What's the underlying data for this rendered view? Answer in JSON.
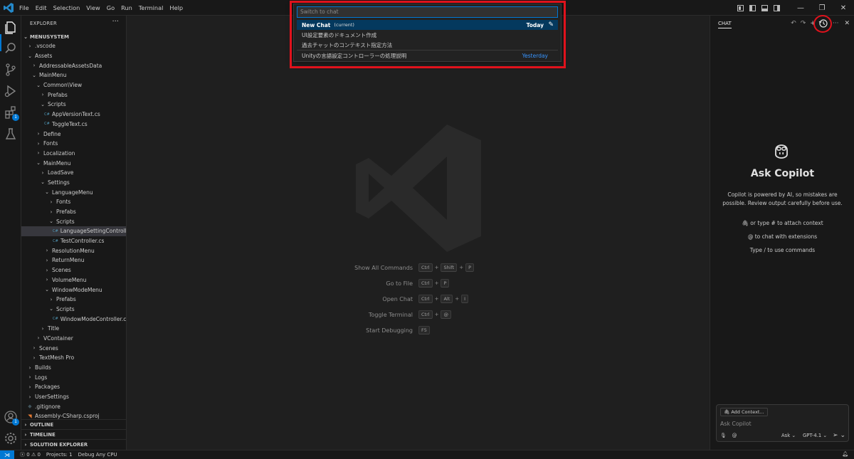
{
  "menu": [
    "File",
    "Edit",
    "Selection",
    "View",
    "Go",
    "Run",
    "Terminal",
    "Help"
  ],
  "window_controls": {
    "minimize": "—",
    "restore": "❐",
    "close": "✕"
  },
  "activity": {
    "extensions_badge": "1",
    "accounts_badge": "1"
  },
  "explorer": {
    "header": "EXPLORER",
    "more": "···",
    "root": "MENUSYSTEM",
    "tree": [
      {
        "label": ".vscode",
        "depth": 1,
        "chev": "›"
      },
      {
        "label": "Assets",
        "depth": 1,
        "chev": "⌄"
      },
      {
        "label": "AddressableAssetsData",
        "depth": 2,
        "chev": "›"
      },
      {
        "label": "MainMenu",
        "depth": 2,
        "chev": "⌄"
      },
      {
        "label": "Common\\View",
        "depth": 3,
        "chev": "⌄"
      },
      {
        "label": "Prefabs",
        "depth": 4,
        "chev": "›"
      },
      {
        "label": "Scripts",
        "depth": 4,
        "chev": "⌄"
      },
      {
        "label": "AppVersionText.cs",
        "depth": 5,
        "icon": "cs"
      },
      {
        "label": "ToggleText.cs",
        "depth": 5,
        "icon": "cs"
      },
      {
        "label": "Define",
        "depth": 3,
        "chev": "›"
      },
      {
        "label": "Fonts",
        "depth": 3,
        "chev": "›"
      },
      {
        "label": "Localization",
        "depth": 3,
        "chev": "›"
      },
      {
        "label": "MainMenu",
        "depth": 3,
        "chev": "⌄"
      },
      {
        "label": "LoadSave",
        "depth": 4,
        "chev": "›"
      },
      {
        "label": "Settings",
        "depth": 4,
        "chev": "⌄"
      },
      {
        "label": "LanguageMenu",
        "depth": 5,
        "chev": "⌄"
      },
      {
        "label": "Fonts",
        "depth": 6,
        "chev": "›"
      },
      {
        "label": "Prefabs",
        "depth": 6,
        "chev": "›"
      },
      {
        "label": "Scripts",
        "depth": 6,
        "chev": "⌄"
      },
      {
        "label": "LanguageSettingControll...",
        "depth": 7,
        "icon": "cs",
        "selected": true
      },
      {
        "label": "TestController.cs",
        "depth": 7,
        "icon": "cs"
      },
      {
        "label": "ResolutionMenu",
        "depth": 5,
        "chev": "›"
      },
      {
        "label": "ReturnMenu",
        "depth": 5,
        "chev": "›"
      },
      {
        "label": "Scenes",
        "depth": 5,
        "chev": "›"
      },
      {
        "label": "VolumeMenu",
        "depth": 5,
        "chev": "›"
      },
      {
        "label": "WindowModeMenu",
        "depth": 5,
        "chev": "⌄"
      },
      {
        "label": "Prefabs",
        "depth": 6,
        "chev": "›"
      },
      {
        "label": "Scripts",
        "depth": 6,
        "chev": "⌄"
      },
      {
        "label": "WindowModeController.cs",
        "depth": 7,
        "icon": "cs"
      },
      {
        "label": "Title",
        "depth": 4,
        "chev": "›"
      },
      {
        "label": "VContainer",
        "depth": 3,
        "chev": "›"
      },
      {
        "label": "Scenes",
        "depth": 2,
        "chev": "›"
      },
      {
        "label": "TextMesh Pro",
        "depth": 2,
        "chev": "›"
      },
      {
        "label": "Builds",
        "depth": 1,
        "chev": "›"
      },
      {
        "label": "Logs",
        "depth": 1,
        "chev": "›"
      },
      {
        "label": "Packages",
        "depth": 1,
        "chev": "›"
      },
      {
        "label": "UserSettings",
        "depth": 1,
        "chev": "›"
      },
      {
        "label": ".gitignore",
        "depth": 1,
        "icon": "git"
      },
      {
        "label": "Assembly-CSharp.csproj",
        "depth": 1,
        "icon": "rss"
      }
    ],
    "sections": [
      "OUTLINE",
      "TIMELINE",
      "SOLUTION EXPLORER"
    ]
  },
  "quickpick": {
    "placeholder": "Switch to chat",
    "items": [
      {
        "label": "New Chat",
        "current": "(current)",
        "group": "Today"
      },
      {
        "label": "UI設定要素のドキュメント作成"
      },
      {
        "label": "過去チャットのコンテキスト指定方法"
      },
      {
        "label": "Unityの言語設定コントローラーの処理説明",
        "group": "Yesterday"
      }
    ]
  },
  "shortcuts": [
    {
      "label": "Show All Commands",
      "keys": [
        "Ctrl",
        "Shift",
        "P"
      ]
    },
    {
      "label": "Go to File",
      "keys": [
        "Ctrl",
        "P"
      ]
    },
    {
      "label": "Open Chat",
      "keys": [
        "Ctrl",
        "Alt",
        "I"
      ]
    },
    {
      "label": "Toggle Terminal",
      "keys": [
        "Ctrl",
        "@"
      ]
    },
    {
      "label": "Start Debugging",
      "keys": [
        "F5"
      ]
    }
  ],
  "chat": {
    "tab": "CHAT",
    "title": "Ask Copilot",
    "desc": "Copilot is powered by AI, so mistakes are possible. Review output carefully before use.",
    "hint_attach": "or type # to attach context",
    "hint_ext": "to chat with extensions",
    "hint_cmd": "Type / to use commands",
    "add_context": "Add Context...",
    "placeholder": "Ask Copilot",
    "mode": "Ask",
    "model": "GPT-4.1"
  },
  "status": {
    "errors": "0",
    "warnings": "0",
    "projects": "Projects: 1",
    "debug": "Debug Any CPU"
  }
}
